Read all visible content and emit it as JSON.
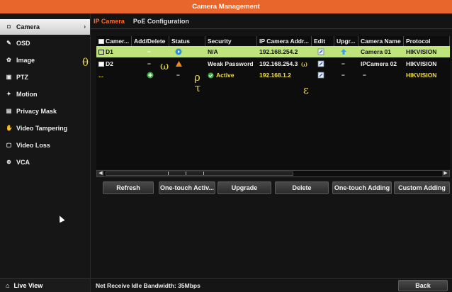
{
  "window": {
    "title": "Camera Management"
  },
  "sidebar": {
    "items": [
      {
        "label": "Camera",
        "icon": "camera-icon",
        "active": true
      },
      {
        "label": "OSD",
        "icon": "osd-icon"
      },
      {
        "label": "Image",
        "icon": "image-icon"
      },
      {
        "label": "PTZ",
        "icon": "ptz-icon"
      },
      {
        "label": "Motion",
        "icon": "motion-icon"
      },
      {
        "label": "Privacy Mask",
        "icon": "privacy-mask-icon"
      },
      {
        "label": "Video Tampering",
        "icon": "video-tampering-icon"
      },
      {
        "label": "Video Loss",
        "icon": "video-loss-icon"
      },
      {
        "label": "VCA",
        "icon": "vca-icon"
      }
    ],
    "live_view": "Live View"
  },
  "tabs": [
    {
      "label": "IP Camera",
      "active": true
    },
    {
      "label": "PoE Configuration"
    }
  ],
  "table": {
    "headers": [
      "Camer...",
      "Add/Delete",
      "Status",
      "Security",
      "IP Camera Addr...",
      "Edit",
      "Upgr...",
      "Camera Name",
      "Protocol"
    ],
    "rows": [
      {
        "channel": "D1",
        "add_delete": "−",
        "status_icon": "play-icon",
        "security": "N/A",
        "ip": "192.168.254.2",
        "edit_icon": "edit-icon",
        "upgrade_icon": "upgrade-icon",
        "name": "Camera 01",
        "protocol": "HIKVISION",
        "selected": true
      },
      {
        "channel": "D2",
        "add_delete": "−",
        "status_icon": "warning-icon",
        "security": "Weak Password",
        "ip": "192.168.254.3",
        "edit_icon": "edit-icon",
        "upgrade": "−",
        "name": "IPCamera 02",
        "protocol": "HIKVISION"
      },
      {
        "channel": "...",
        "add_delete_icon": "add-icon",
        "status": "−",
        "security": "Active",
        "ip": "192.168.1.2",
        "edit_icon": "edit-icon",
        "upgrade": "−",
        "name": "−",
        "protocol": "HIKVISION"
      }
    ]
  },
  "buttons": [
    "Refresh",
    "One-touch Activ...",
    "Upgrade",
    "Delete",
    "One-touch Adding",
    "Custom Adding"
  ],
  "status_bar": {
    "text": "Net Receive Idle Bandwidth: 35Mbps",
    "back": "Back"
  },
  "overlay_glyphs": [
    "θ",
    "ω",
    "ρ",
    "τ",
    "ε",
    "ω"
  ],
  "colors": {
    "title_bar": "#e8662c",
    "selected_row": "#bfe47b",
    "active_tab": "#ff6a2b",
    "highlight_text": "#f3df3c"
  }
}
